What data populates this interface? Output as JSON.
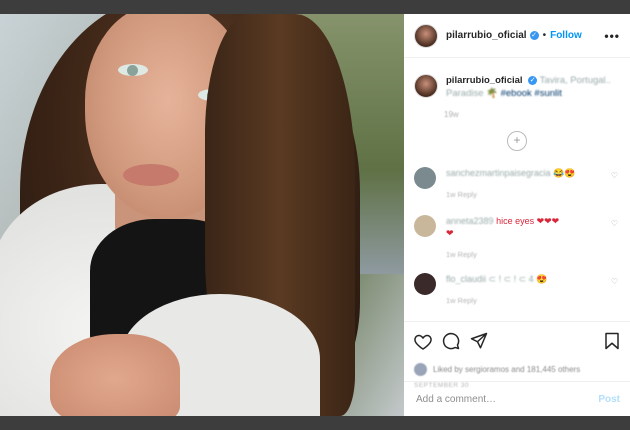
{
  "post": {
    "username": "pilarrubio_oficial",
    "verified_icon": "verified-badge-icon",
    "dot": "•",
    "follow_label": "Follow",
    "more_label": "•••"
  },
  "caption": {
    "username": "pilarrubio_oficial",
    "text": "Tavira, Portugal..",
    "text2": "Paradise 🌴",
    "hashtag": "#ebook #sunlit",
    "time": "19w"
  },
  "comments": [
    {
      "user": "sanchezmartinpaisegracia",
      "text": "😂😍",
      "meta": "1w   Reply",
      "color": "#7b8a8f"
    },
    {
      "user": "anneta2389",
      "text": "hice eyes ❤❤❤",
      "text2": "❤",
      "meta": "1w   Reply",
      "color": "#c9b79c"
    },
    {
      "user": "flo_claudii",
      "text": "⊂ ! ⊂ ! ⊂ 4",
      "emoji": "😍",
      "meta": "1w   Reply",
      "color": "#3a2a2a"
    }
  ],
  "actions": {
    "likes_text": "Liked by sergioramos and 181,445 others",
    "date": "SEPTEMBER 30"
  },
  "add_comment": {
    "placeholder": "Add a comment…",
    "post_label": "Post"
  },
  "colors": {
    "accent": "#0095f6",
    "verified": "#3897f0"
  }
}
